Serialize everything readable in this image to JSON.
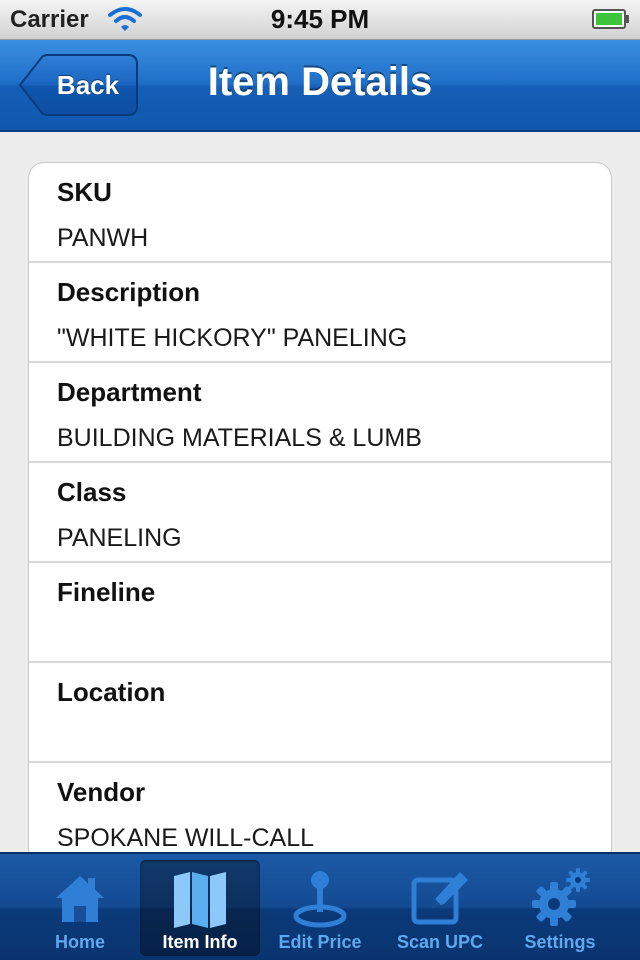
{
  "status_bar": {
    "carrier": "Carrier",
    "time": "9:45 PM",
    "icons": [
      "wifi-icon",
      "battery-icon"
    ]
  },
  "nav_bar": {
    "back_label": "Back",
    "title": "Item Details",
    "color": "#1f6fc8"
  },
  "details": [
    {
      "label": "SKU",
      "value": "PANWH"
    },
    {
      "label": "Description",
      "value": "\"WHITE HICKORY\" PANELING"
    },
    {
      "label": "Department",
      "value": "BUILDING MATERIALS & LUMB"
    },
    {
      "label": "Class",
      "value": "PANELING"
    },
    {
      "label": "Fineline",
      "value": ""
    },
    {
      "label": "Location",
      "value": ""
    },
    {
      "label": "Vendor",
      "value": "SPOKANE WILL-CALL"
    }
  ],
  "tab_bar": {
    "tabs": [
      {
        "label": "Home",
        "icon": "home-icon",
        "selected": false
      },
      {
        "label": "Item Info",
        "icon": "map-icon",
        "selected": true
      },
      {
        "label": "Edit Price",
        "icon": "joystick-icon",
        "selected": false
      },
      {
        "label": "Scan UPC",
        "icon": "edit-icon",
        "selected": false
      },
      {
        "label": "Settings",
        "icon": "gears-icon",
        "selected": false
      }
    ],
    "active_color": "#ffffff",
    "inactive_color": "#5fa8ee"
  }
}
